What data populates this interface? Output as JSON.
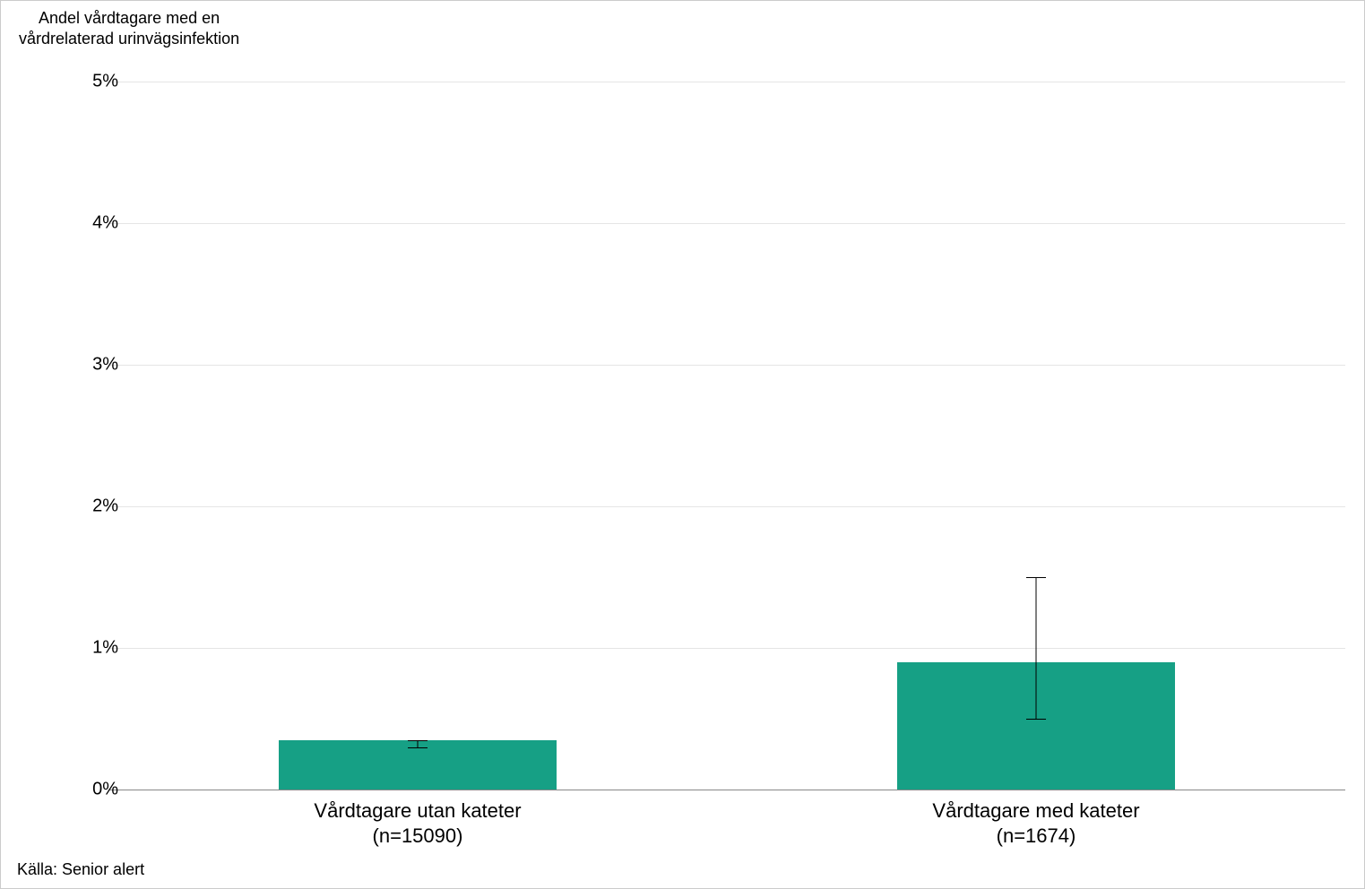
{
  "subtitle_line1": "Andel vårdtagare med en",
  "subtitle_line2": "vårdrelaterad urinvägsinfektion",
  "source": "Källa: Senior alert",
  "y_ticks": [
    "0%",
    "1%",
    "2%",
    "3%",
    "4%",
    "5%"
  ],
  "x_ticks": [
    {
      "line1": "Vårdtagare utan kateter",
      "line2": "(n=15090)"
    },
    {
      "line1": "Vårdtagare med kateter",
      "line2": "(n=1674)"
    }
  ],
  "chart_data": {
    "type": "bar",
    "title": "",
    "subtitle": "Andel vårdtagare med en vårdrelaterad urinvägsinfektion",
    "ylabel": "Andel vårdtagare med en vårdrelaterad urinvägsinfektion",
    "xlabel": "",
    "ylim": [
      0,
      5
    ],
    "y_unit": "%",
    "source": "Senior alert",
    "categories": [
      "Vårdtagare utan kateter (n=15090)",
      "Vårdtagare med kateter (n=1674)"
    ],
    "values": [
      0.35,
      0.9
    ],
    "error_bars": [
      {
        "low": 0.3,
        "high": 0.35
      },
      {
        "low": 0.5,
        "high": 1.5
      }
    ],
    "color": "#16a085"
  }
}
